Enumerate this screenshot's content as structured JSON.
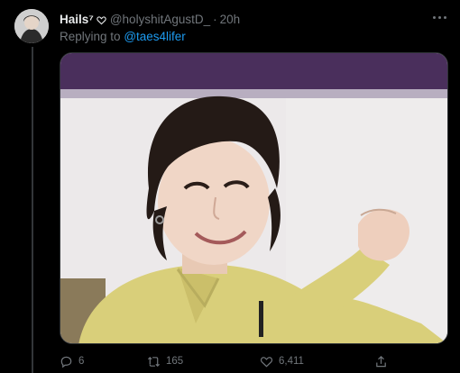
{
  "tweet": {
    "display_name": "Hails⁷",
    "handle": "@holyshitAgustD_",
    "separator": "·",
    "time": "20h",
    "replying_prefix": "Replying to",
    "replying_to": "@taes4lifer",
    "icons": {
      "name_badge": "heart-icon",
      "more": "more-icon",
      "reply": "reply-icon",
      "retweet": "retweet-icon",
      "like": "like-icon",
      "share": "share-icon"
    }
  },
  "actions": {
    "replies": "6",
    "retweets": "165",
    "likes": "6,411"
  },
  "colors": {
    "background": "#000000",
    "text": "#e7e9ea",
    "secondary": "#71767b",
    "link": "#1d9bf0",
    "divider": "#333639"
  }
}
